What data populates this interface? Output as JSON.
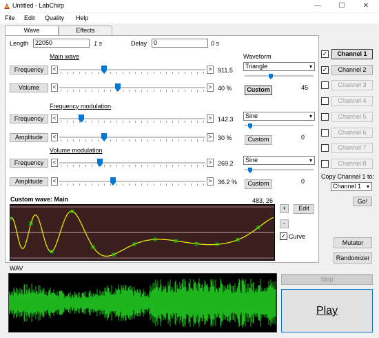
{
  "window": {
    "title": "Untitled - LabChirp",
    "minimize": "—",
    "maximize": "☐",
    "close": "✕"
  },
  "menu": [
    "File",
    "Edit",
    "Quality",
    "Help"
  ],
  "tabs": [
    "Wave",
    "Effects"
  ],
  "length": {
    "label": "Length",
    "value": "22050",
    "unit": "1 s"
  },
  "delay": {
    "label": "Delay",
    "value": "0",
    "unit": "0 s"
  },
  "sections": {
    "main_wave": "Main wave",
    "freq_mod": "Frequency modulation",
    "vol_mod": "Volume modulation"
  },
  "sliders": [
    {
      "button": "Frequency",
      "value": "911.5",
      "fraction": 0.29
    },
    {
      "button": "Volume",
      "value": "40 %",
      "fraction": 0.38
    },
    {
      "button": "Frequency",
      "value": "142.3",
      "fraction": 0.13
    },
    {
      "button": "Amplitude",
      "value": "30 %",
      "fraction": 0.29
    },
    {
      "button": "Frequency",
      "value": "269.2",
      "fraction": 0.26
    },
    {
      "button": "Amplitude",
      "value": "36.2 %",
      "fraction": 0.35
    }
  ],
  "waveform": {
    "label": "Waveform",
    "groups": [
      {
        "selected": "Triangle",
        "button": "Custom",
        "value": "45",
        "bold": true,
        "fraction": 0.35
      },
      {
        "selected": "Sine",
        "button": "Custom",
        "value": "0",
        "bold": false,
        "fraction": 0.05
      },
      {
        "selected": "Sine",
        "button": "Custom",
        "value": "0",
        "bold": false,
        "fraction": 0.05
      }
    ]
  },
  "custom_wave": {
    "title": "Custom wave: Main",
    "coords": "483, 26",
    "edit": "Edit",
    "plus": "+",
    "minus": "-",
    "curve_label": "Curve",
    "curve_checked": true
  },
  "channels": [
    {
      "label": "Channel 1",
      "checked": true,
      "state": "bold"
    },
    {
      "label": "Channel 2",
      "checked": true,
      "state": "normal"
    },
    {
      "label": "Channel 3",
      "checked": false,
      "state": "disabled"
    },
    {
      "label": "Channel 4",
      "checked": false,
      "state": "disabled"
    },
    {
      "label": "Channel 5",
      "checked": false,
      "state": "disabled"
    },
    {
      "label": "Channel 6",
      "checked": false,
      "state": "disabled"
    },
    {
      "label": "Channel 7",
      "checked": false,
      "state": "disabled"
    },
    {
      "label": "Channel 8",
      "checked": false,
      "state": "disabled"
    }
  ],
  "copy": {
    "label": "Copy Channel 1 to:",
    "selected": "Channel 1",
    "go": "Go!"
  },
  "mutator": "Mutator",
  "randomizer": "Randomizer",
  "wav_label": "WAV",
  "stop": "Stop",
  "play": "Play",
  "colors": {
    "wave_line": "#e8e800",
    "wave_point": "#00cc00",
    "wav_fill": "#1fb51f",
    "wave_bg": "#3b1f1f"
  }
}
